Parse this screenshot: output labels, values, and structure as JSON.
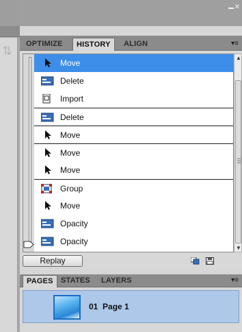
{
  "tabs": {
    "items": [
      {
        "label": "OPTIMIZE",
        "active": false
      },
      {
        "label": "HISTORY",
        "active": true
      },
      {
        "label": "ALIGN",
        "active": false
      }
    ]
  },
  "history": {
    "items": [
      {
        "label": "Move",
        "icon": "cursor-icon",
        "selected": true
      },
      {
        "label": "Delete",
        "icon": "delete-icon"
      },
      {
        "label": "Import",
        "icon": "import-icon"
      },
      {
        "label": "Delete",
        "icon": "delete-icon"
      },
      {
        "label": "Move",
        "icon": "cursor-icon"
      },
      {
        "label": "Move",
        "icon": "cursor-icon"
      },
      {
        "label": "Move",
        "icon": "cursor-icon"
      },
      {
        "label": "Group",
        "icon": "group-icon"
      },
      {
        "label": "Move",
        "icon": "cursor-icon"
      },
      {
        "label": "Opacity",
        "icon": "opacity-icon"
      },
      {
        "label": "Opacity",
        "icon": "opacity-icon"
      }
    ],
    "replay_label": "Replay"
  },
  "pages_tabs": {
    "items": [
      {
        "label": "PAGES",
        "active": true
      },
      {
        "label": "STATES",
        "active": false
      },
      {
        "label": "LAYERS",
        "active": false
      }
    ]
  },
  "pages": {
    "items": [
      {
        "label": "01  Page 1"
      }
    ]
  },
  "colors": {
    "selection": "#3d8ee8",
    "page_row": "#aec8ea"
  }
}
